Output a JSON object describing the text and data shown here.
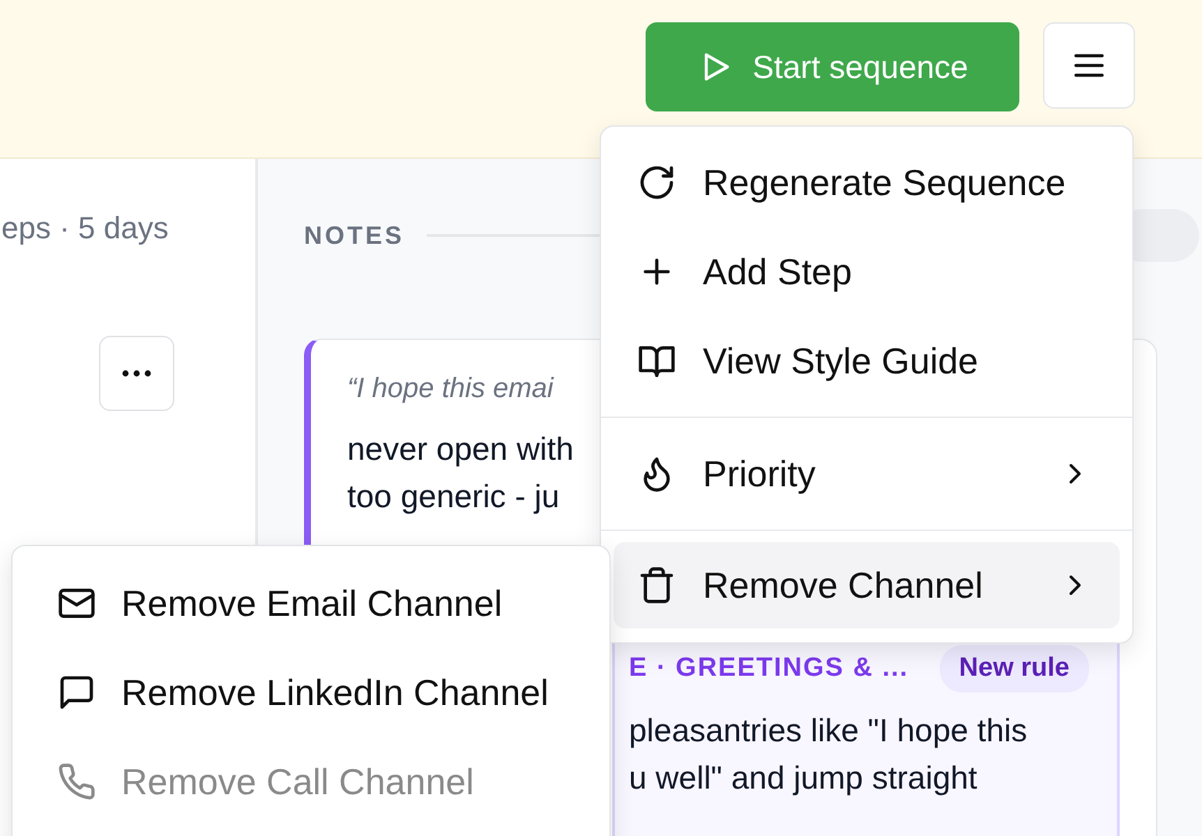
{
  "header": {
    "start_button": "Start sequence"
  },
  "sidebar": {
    "meta": "eps · 5 days"
  },
  "notes": {
    "heading": "NOTES",
    "quote": "“I hope this emai",
    "body_lines": [
      "never open with",
      "too generic - ju"
    ],
    "rule": {
      "heading": "E · GREETINGS & ...",
      "badge": "New rule",
      "lines": [
        "pleasantries like \"I hope this",
        "u well\" and jump straight"
      ]
    }
  },
  "menu": {
    "groups": [
      [
        {
          "label": "Regenerate Sequence",
          "submenu": false,
          "highlighted": false
        },
        {
          "label": "Add Step",
          "submenu": false,
          "highlighted": false
        },
        {
          "label": "View Style Guide",
          "submenu": false,
          "highlighted": false
        }
      ],
      [
        {
          "label": "Priority",
          "submenu": true,
          "highlighted": false
        }
      ],
      [
        {
          "label": "Remove Channel",
          "submenu": true,
          "highlighted": true
        }
      ]
    ]
  },
  "submenu": {
    "items": [
      {
        "label": "Remove Email Channel",
        "disabled": false
      },
      {
        "label": "Remove LinkedIn Channel",
        "disabled": false
      },
      {
        "label": "Remove Call Channel",
        "disabled": true
      }
    ]
  }
}
